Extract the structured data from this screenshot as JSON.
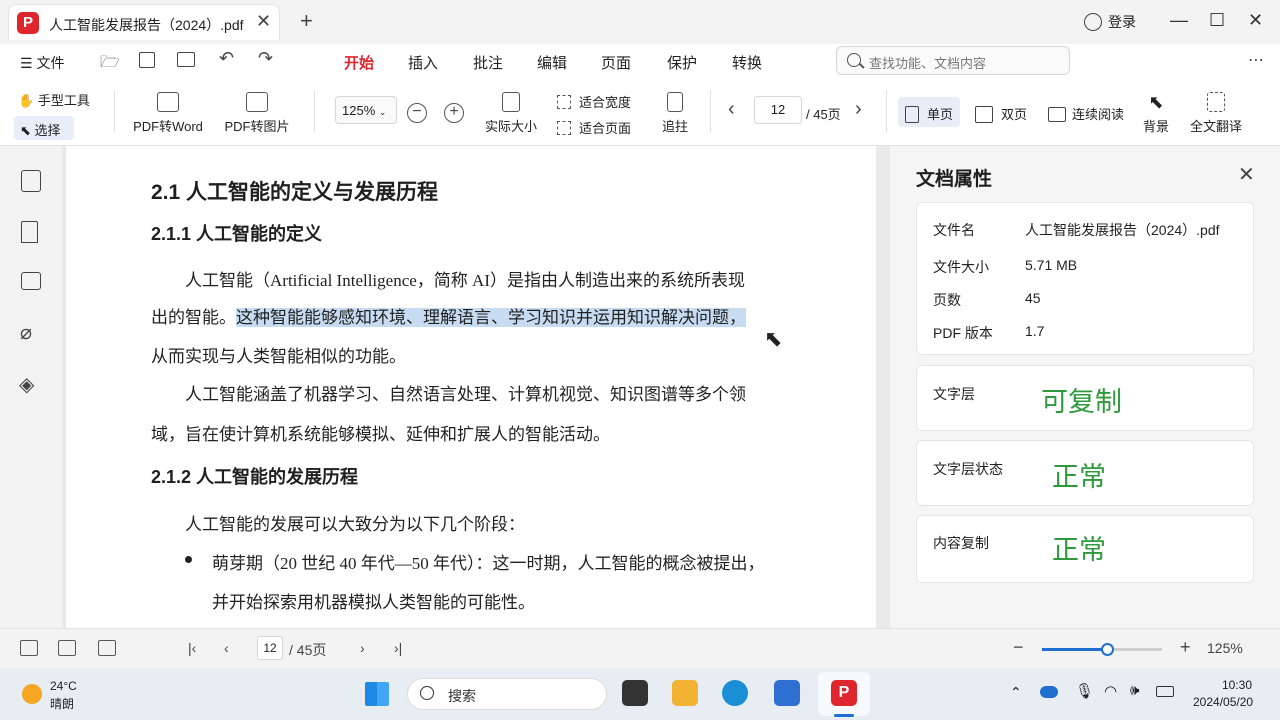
{
  "tab": {
    "title": "人工智能发展报告（2024）.pdf",
    "close": "✕",
    "new": "+"
  },
  "window": {
    "login": "登录",
    "minimize": "—",
    "maximize": "☐",
    "close": "✕"
  },
  "menu": {
    "file": "文件",
    "items": [
      "开始",
      "插入",
      "批注",
      "编辑",
      "页面",
      "保护",
      "转换"
    ],
    "search_placeholder": "查找功能、文档内容"
  },
  "toolbar": {
    "hand": "手型工具",
    "select": "选择",
    "pdf2word": "PDF转Word",
    "pdf2img": "PDF转图片",
    "zoom": "125%",
    "actual": "实际大小",
    "fit_width": "适合宽度",
    "fit_page": "适合页面",
    "crop": "追拄",
    "page": "12",
    "total": "/ 45页",
    "single": "单页",
    "double": "双页",
    "continuous": "连续阅读",
    "background": "背景",
    "translate": "全文翻译"
  },
  "doc": {
    "h1": "2.1 人工智能的定义与发展历程",
    "h2a": "2.1.1 人工智能的定义",
    "p1_l1": "人工智能（Artificial Intelligence，简称 AI）是指由人制造出来的系统所表现",
    "p1_l2a": "出的智能。",
    "p1_l2b": "这种智能能够感知环境、理解语言、学习知识并运用知识解决问题，",
    "p1_l3": "从而实现与人类智能相似的功能。",
    "p2_l1": "人工智能涵盖了机器学习、自然语言处理、计算机视觉、知识图谱等多个领",
    "p2_l2": "域，旨在使计算机系统能够模拟、延伸和扩展人的智能活动。",
    "h2b": "2.1.2 人工智能的发展历程",
    "p3": "人工智能的发展可以大致分为以下几个阶段：",
    "b1_l1": "萌芽期（20 世纪 40 年代—50 年代）：这一时期，人工智能的概念被提出，",
    "b1_l2": "并开始探索用机器模拟人类智能的可能性。"
  },
  "panel": {
    "title": "文档属性",
    "close": "✕",
    "props": [
      {
        "label": "文件名",
        "value": "人工智能发展报告（2024）.pdf"
      },
      {
        "label": "文件大小",
        "value": "5.71 MB"
      },
      {
        "label": "页数",
        "value": "45"
      },
      {
        "label": "PDF 版本",
        "value": "1.7"
      }
    ],
    "text_layer_label": "文字层",
    "text_layer_value": "可复制",
    "text_state_label": "文字层状态",
    "text_state_value": "正常",
    "copy_label": "内容复制",
    "copy_value": "正常"
  },
  "status": {
    "page": "12",
    "total": "/ 45页",
    "zoom": "125%",
    "zoom_level": 0.55
  },
  "taskbar": {
    "temp": "24°C",
    "weather": "晴朗",
    "search": "搜索",
    "time": "10:30",
    "date": "2024/05/20"
  },
  "colors": {
    "accent": "#e0262d",
    "green": "#2f9a3b",
    "highlight": "#c7dcf2"
  }
}
